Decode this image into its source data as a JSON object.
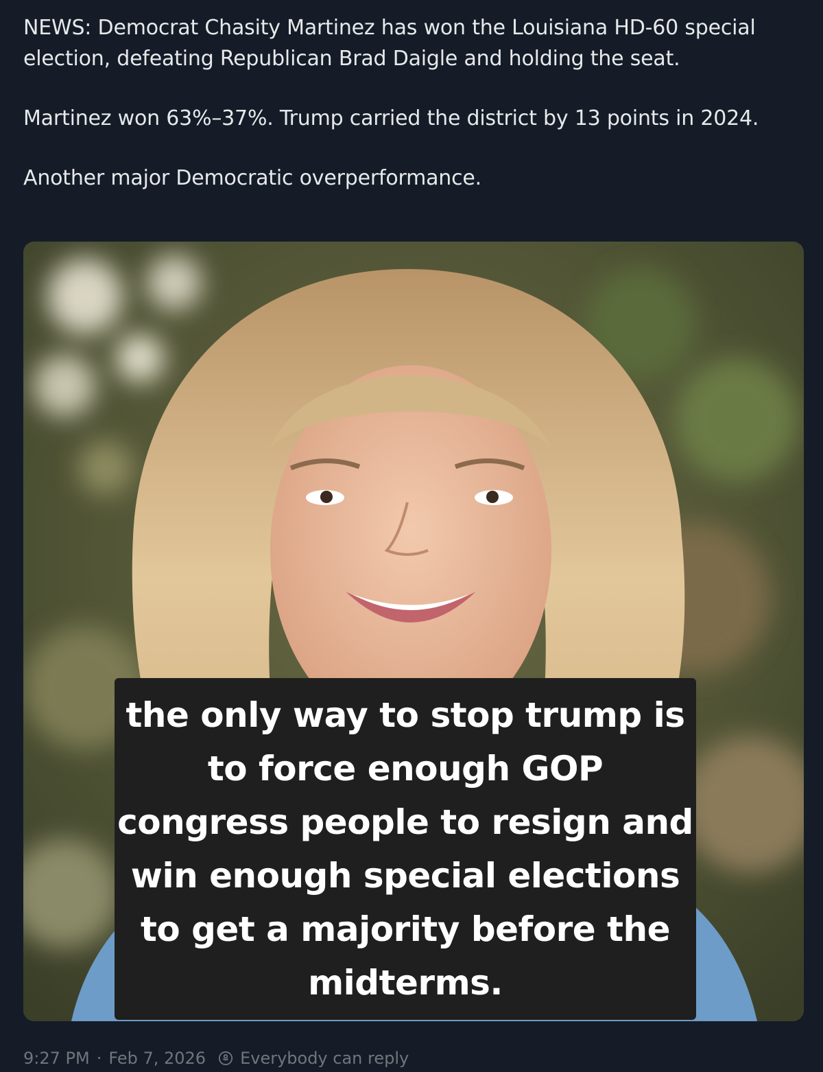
{
  "post": {
    "paragraphs": [
      "NEWS: Democrat Chasity Martinez has won the Louisiana HD-60 special election, defeating Republican Brad Daigle and holding the seat.",
      "Martinez won 63%–37%. Trump carried the district by 13 points in 2024.",
      "Another major Democratic overperformance."
    ],
    "image_caption": "the only way to stop trump is to force enough GOP congress people to resign and win enough special elections to get a majority before the midterms.",
    "time": "9:27 PM",
    "date": "Feb 7, 2026",
    "reply_setting": "Everybody can reply",
    "reply_icon": "reply-permission-icon"
  },
  "colors": {
    "background": "#151c28",
    "text": "#e7e9ea",
    "muted": "#71767b",
    "caption_box": "#1f1f1f"
  }
}
